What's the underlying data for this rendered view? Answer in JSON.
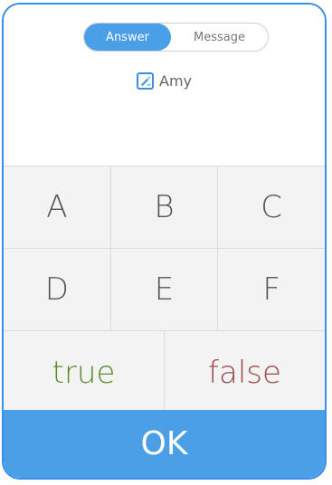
{
  "tabs": {
    "answer_label": "Answer",
    "message_label": "Message"
  },
  "student": {
    "name": "Amy",
    "icon": "edit-icon"
  },
  "keypad": {
    "rows": [
      [
        "A",
        "B",
        "C"
      ],
      [
        "D",
        "E",
        "F"
      ]
    ],
    "true_label": "true",
    "false_label": "false"
  },
  "ok_label": "OK",
  "colors": {
    "accent": "#4a9fe6",
    "true": "#5a8b2e",
    "false": "#9b4a4a"
  }
}
